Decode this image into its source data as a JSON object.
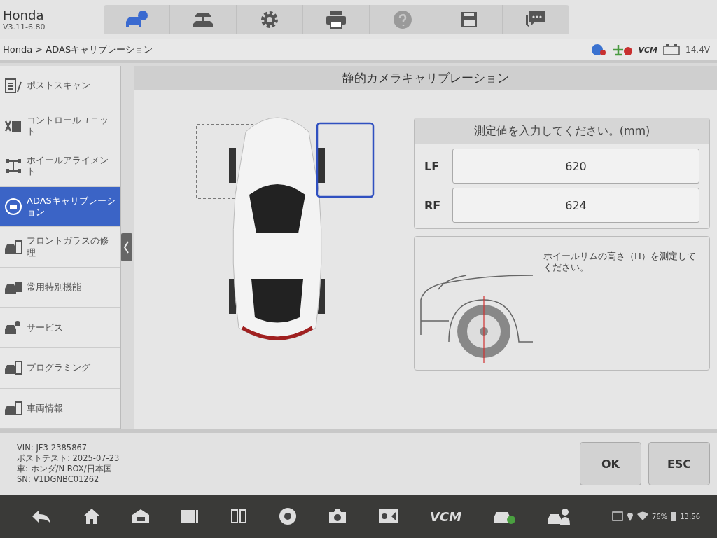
{
  "header": {
    "title": "Honda",
    "version": "V3.11-6.80"
  },
  "toolbar": [
    {
      "kind": "car-cloud",
      "selected": true
    },
    {
      "kind": "lift",
      "selected": false
    },
    {
      "kind": "settings",
      "selected": false
    },
    {
      "kind": "print",
      "selected": false
    },
    {
      "kind": "help",
      "selected": false
    },
    {
      "kind": "save",
      "selected": false
    },
    {
      "kind": "chat",
      "selected": false
    }
  ],
  "breadcrumb": "Honda > ADASキャリブレーション",
  "connection": {
    "vcm": "VCM",
    "voltage": "14.4V"
  },
  "sidebar": {
    "items": [
      {
        "kind": "clipboard",
        "label": "ポストスキャン",
        "selected": false
      },
      {
        "kind": "module",
        "label": "コントロールユニット",
        "selected": false
      },
      {
        "kind": "alignment",
        "label": "ホイールアライメント",
        "selected": false
      },
      {
        "kind": "adas",
        "label": "ADASキャリブレーション",
        "selected": true
      },
      {
        "kind": "windshield",
        "label": "フロントガラスの修理",
        "selected": false
      },
      {
        "kind": "grid",
        "label": "常用特別機能",
        "selected": false
      },
      {
        "kind": "service",
        "label": "サービス",
        "selected": false
      },
      {
        "kind": "programming",
        "label": "プログラミング",
        "selected": false
      },
      {
        "kind": "info",
        "label": "車両情報",
        "selected": false
      }
    ]
  },
  "panel": {
    "title": "静的カメラキャリブレーション",
    "input_title": "測定値を入力してください。(mm)",
    "fields": [
      {
        "label": "LF",
        "value": "620"
      },
      {
        "label": "RF",
        "value": "624"
      }
    ],
    "hint": "ホイールリムの高さ（H）を測定してください。"
  },
  "vehicle_info": [
    "VIN: JF3-2385867",
    "ポストテスト: 2025-07-23",
    "車: ホンダ/N-BOX/日本国",
    "SN: V1DGNBC01262"
  ],
  "buttons": [
    "OK",
    "ESC"
  ],
  "navbar": {
    "vcm": "VCM",
    "battery": "76%",
    "time": "13:56"
  }
}
